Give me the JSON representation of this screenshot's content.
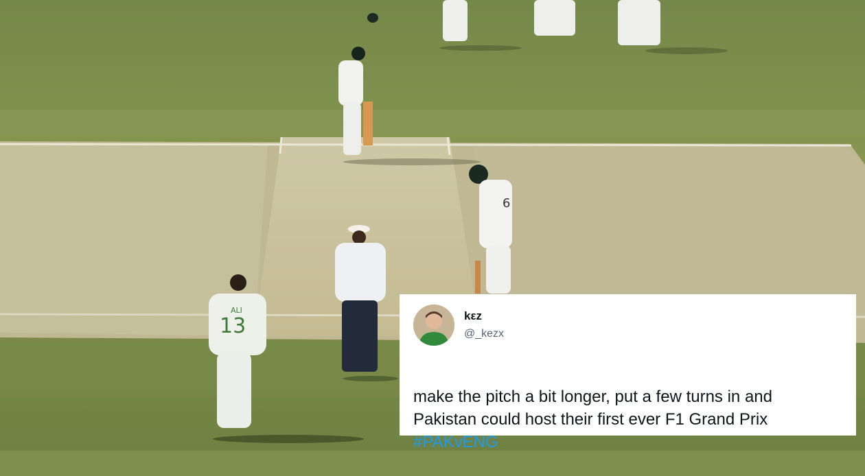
{
  "scene": {
    "description_icon": "cricket-match-broadcast",
    "colors": {
      "outfield": "#7d8d4c",
      "pitch": "#c9c2a0",
      "white_kit": "#eef0ee",
      "green_kit": "#3e7a3a"
    },
    "player_numbers": {
      "bowler_number": "13",
      "bowler_name": "ALI",
      "non_striker_number": "6"
    }
  },
  "tweet": {
    "display_name": "kεz",
    "handle": "@_kezx",
    "text": "make the pitch a bit longer, put a few turns in and\nPakistan could host their first ever F1 Grand Prix",
    "hashtag": "#PAKvENG",
    "colors": {
      "text": "#0f1419",
      "handle": "#536471",
      "hashtag": "#1d9bf0"
    }
  }
}
